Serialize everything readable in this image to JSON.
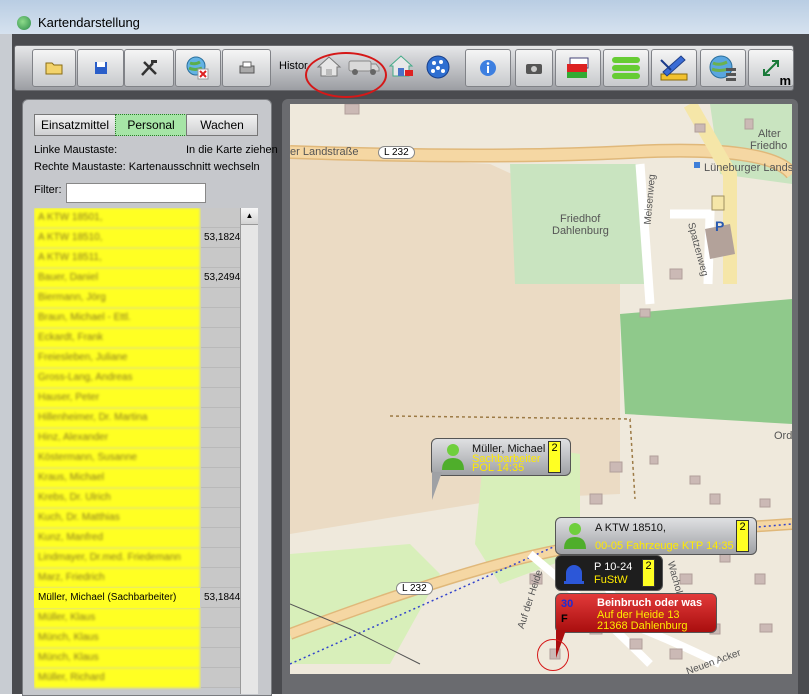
{
  "window": {
    "title": "Kartendarstellung"
  },
  "toolbar": {
    "history_label": "Histor",
    "buttons": [
      "open-folder-icon",
      "save-disk-icon",
      "tools-icon",
      "globe-delete-icon",
      "printer-icon",
      "home-icon",
      "vehicle-icon",
      "home-alert-icon",
      "globe-dots-icon",
      "info-icon",
      "camera-icon",
      "layers-icon",
      "green-bars-icon",
      "pencil-ruler-icon",
      "globe-list-icon",
      "measure-icon"
    ],
    "measure_label": "m"
  },
  "tabs": [
    {
      "label": "Einsatzmittel",
      "active": false
    },
    {
      "label": "Personal",
      "active": true
    },
    {
      "label": "Wachen",
      "active": false
    }
  ],
  "help": {
    "left_key": "Linke Maustaste:",
    "left_val": "In die Karte ziehen",
    "right_key": "Rechte Maustaste:",
    "right_val": "Kartenausschnitt wechseln"
  },
  "filter": {
    "label": "Filter:",
    "value": ""
  },
  "personnel": [
    {
      "name": "A KTW 18501,",
      "value": "",
      "blur": true
    },
    {
      "name": "A KTW 18510,",
      "value": "53,1824",
      "blur": true
    },
    {
      "name": "A KTW 18511,",
      "value": "",
      "blur": true
    },
    {
      "name": "Bauer, Daniel",
      "value": "53,2494",
      "blur": true
    },
    {
      "name": "Biermann, Jörg",
      "value": "",
      "blur": true
    },
    {
      "name": "Braun, Michael - Ettl.",
      "value": "",
      "blur": true
    },
    {
      "name": "Eckardt, Frank",
      "value": "",
      "blur": true
    },
    {
      "name": "Freiesleben, Juliane",
      "value": "",
      "blur": true
    },
    {
      "name": "Gross-Lang, Andreas",
      "value": "",
      "blur": true
    },
    {
      "name": "Hauser, Peter",
      "value": "",
      "blur": true
    },
    {
      "name": "Hillenheimer, Dr. Martina",
      "value": "",
      "blur": true
    },
    {
      "name": "Hinz, Alexander",
      "value": "",
      "blur": true
    },
    {
      "name": "Köstermann, Susanne",
      "value": "",
      "blur": true
    },
    {
      "name": "Kraus, Michael",
      "value": "",
      "blur": true
    },
    {
      "name": "Krebs, Dr. Ulrich",
      "value": "",
      "blur": true
    },
    {
      "name": "Kuch, Dr. Matthias",
      "value": "",
      "blur": true
    },
    {
      "name": "Kunz, Manfred",
      "value": "",
      "blur": true
    },
    {
      "name": "Lindmayer, Dr.med. Friedemann",
      "value": "",
      "blur": true
    },
    {
      "name": "Marz, Friedrich",
      "value": "",
      "blur": true
    },
    {
      "name": "Müller, Michael (Sachbarbeiter)",
      "value": "53,1844",
      "blur": false
    },
    {
      "name": "Müller, Klaus",
      "value": "",
      "blur": true
    },
    {
      "name": "Münch, Klaus",
      "value": "",
      "blur": true
    },
    {
      "name": "Münch, Klaus",
      "value": "",
      "blur": true
    },
    {
      "name": "Müller, Richard",
      "value": "",
      "blur": true
    }
  ],
  "map": {
    "labels": {
      "road_landstrasse": "er Landstraße",
      "l232_top": "L 232",
      "lueneburger": "Lüneburger Lands",
      "friedhof": "Friedhof",
      "dahlenburg": "Dahlenburg",
      "meisenweg": "Meisenweg",
      "spatz": "Spatzenweg",
      "alter": "Alter",
      "friedhof2": "Friedho",
      "ord": "Ord",
      "parking": "P",
      "l232_bottom": "L 232",
      "auf_der_heide": "Auf der Heide",
      "wacholder": "Wachol",
      "neuen_acker": "Neuen Acker"
    },
    "callouts": {
      "mueller": {
        "name": "Müller, Michael",
        "role": "Sachbarbeiter",
        "station": "POL 14:35",
        "count": "2"
      },
      "ktw": {
        "name": "A KTW 18510,",
        "info": "00-05 Fahrzeuge KTP 14:35",
        "count": "2"
      },
      "police": {
        "name": "P 10-24",
        "info": "FuStW",
        "count": "2"
      },
      "incident": {
        "title": "Beinbruch oder was",
        "street": "Auf der Heide 13",
        "city": "21368 Dahlenburg",
        "code": "30",
        "type": "F"
      }
    }
  }
}
